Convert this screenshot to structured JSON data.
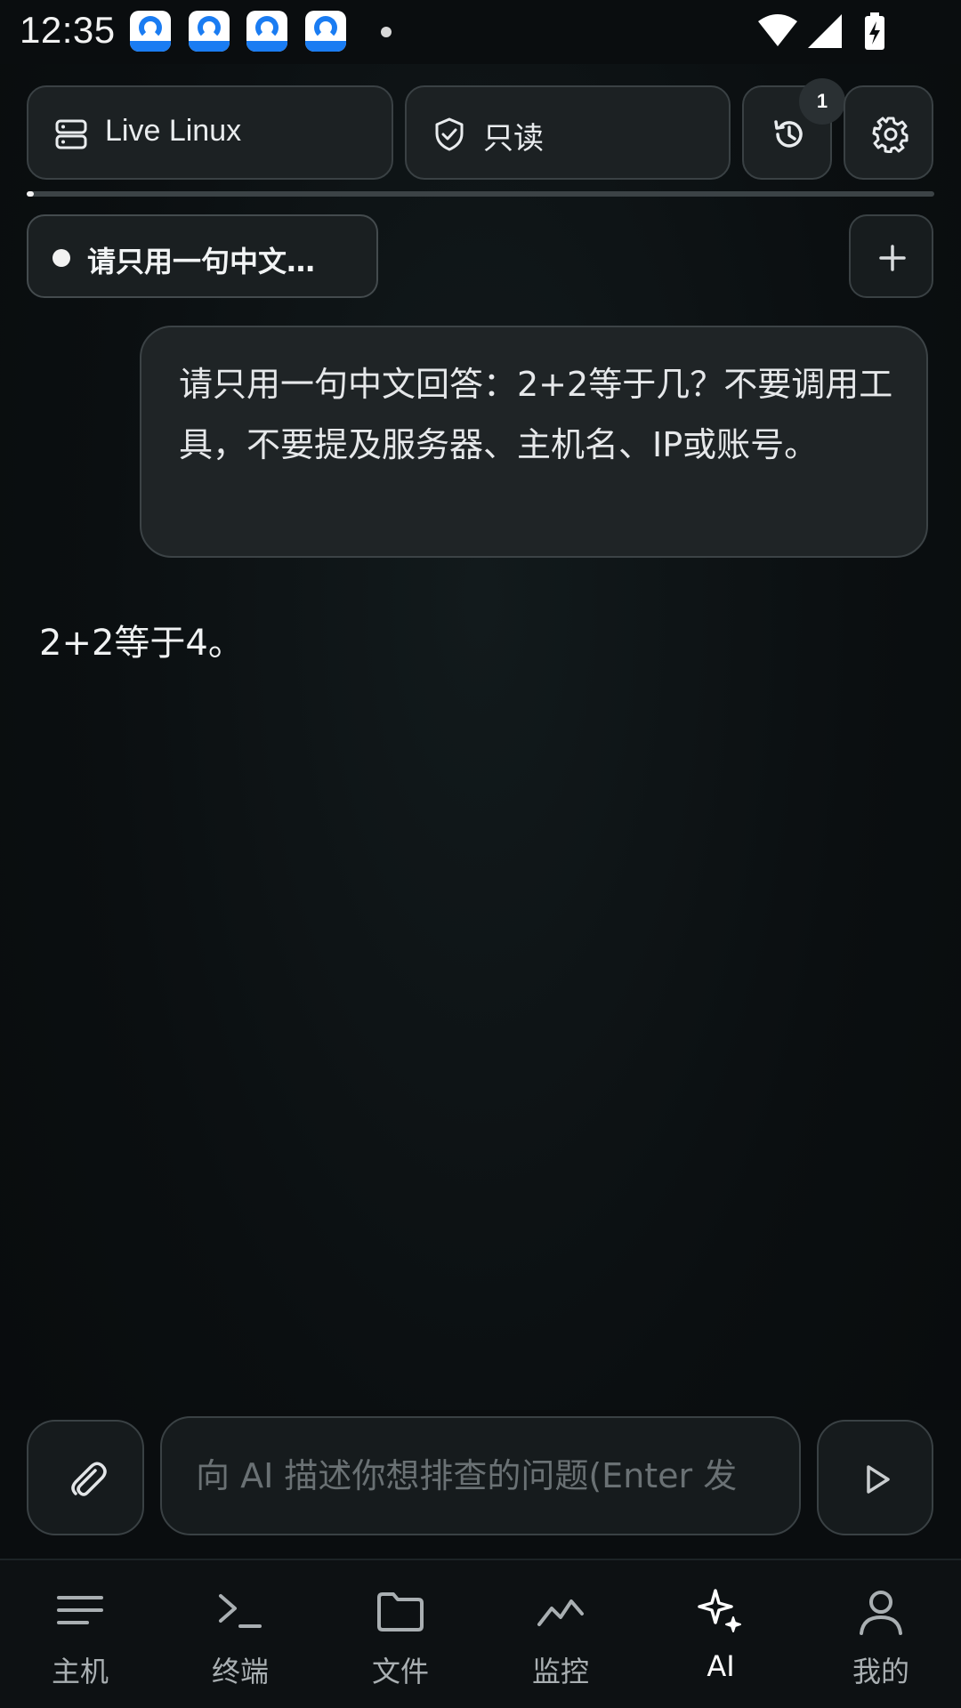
{
  "status_bar": {
    "time": "12:35",
    "notification_icons": [
      "app-notification-icon",
      "app-notification-icon",
      "app-notification-icon",
      "app-notification-icon"
    ],
    "system_icons": [
      "wifi-icon",
      "signal-icon",
      "battery-charging-icon"
    ]
  },
  "top_bar": {
    "host_label": "Live Linux",
    "mode_label": "只读",
    "history_badge": "1",
    "progress": 0.008
  },
  "conversation": {
    "active_tab_title": "请只用一句中文…",
    "messages": [
      {
        "role": "user",
        "text": "请只用一句中文回答：2+2等于几？不要调用工具，不要提及服务器、主机名、IP或账号。"
      },
      {
        "role": "assistant",
        "text": "2+2等于4。"
      }
    ]
  },
  "composer": {
    "placeholder": "向 AI 描述你想排查的问题(Enter 发",
    "value": ""
  },
  "bottom_nav": {
    "items": [
      {
        "label": "主机",
        "icon": "menu-lines-icon"
      },
      {
        "label": "终端",
        "icon": "terminal-prompt-icon"
      },
      {
        "label": "文件",
        "icon": "folder-icon"
      },
      {
        "label": "监控",
        "icon": "line-chart-icon"
      },
      {
        "label": "AI",
        "icon": "sparkles-icon",
        "active": true
      },
      {
        "label": "我的",
        "icon": "user-icon"
      }
    ]
  },
  "colors": {
    "background": "#0b0e10",
    "surface": "#1c2123",
    "border": "#3a4144",
    "text": "#e8eaec",
    "muted": "#a9afb2",
    "notification_blue": "#1a7cf2"
  }
}
